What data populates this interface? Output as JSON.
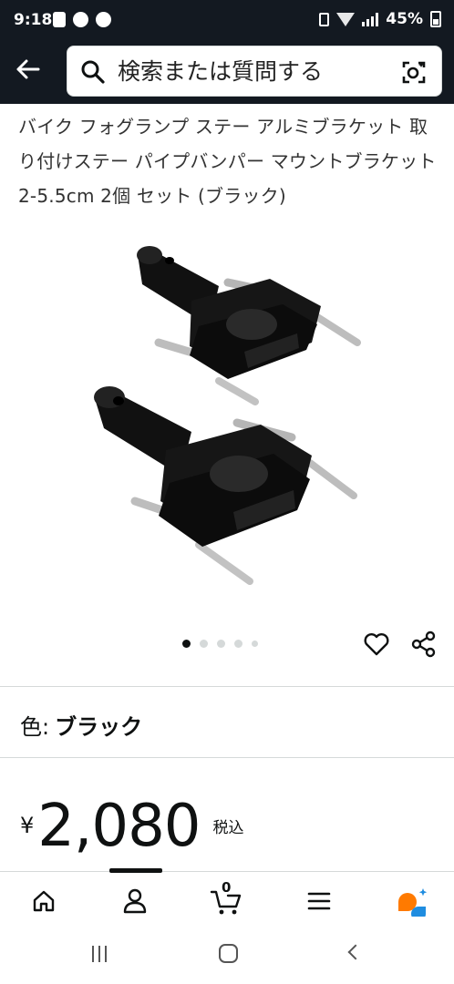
{
  "status_bar": {
    "time": "9:18",
    "battery": "45%"
  },
  "header": {
    "search_placeholder": "検索または質問する",
    "icons": [
      "back-arrow-icon",
      "search-icon",
      "camera-lens-icon"
    ]
  },
  "product": {
    "title": "バイク フォグランプ ステー アルミブラケット 取り付けステー パイプバンパー マウントブラケット 2-5.5cm 2個 セット (ブラック)",
    "image_count": 5,
    "active_image_index": 0,
    "color_label": "色:",
    "color_value": "ブラック",
    "price_symbol": "¥",
    "price_value": "2,080",
    "price_tax_label": "税込"
  },
  "bottom_nav": {
    "items": [
      {
        "name": "home",
        "icon": "home-icon"
      },
      {
        "name": "account",
        "icon": "person-icon"
      },
      {
        "name": "cart",
        "icon": "cart-icon"
      },
      {
        "name": "menu",
        "icon": "menu-icon"
      },
      {
        "name": "rufus",
        "icon": "ai-chat-icon"
      }
    ],
    "cart_count": "0",
    "active_index": 1
  },
  "colors": {
    "header_bg": "#131921",
    "text": "#0f1111",
    "divider": "#d5d9d9",
    "rufus_orange": "#ff7a00",
    "rufus_blue": "#1f8de0"
  }
}
